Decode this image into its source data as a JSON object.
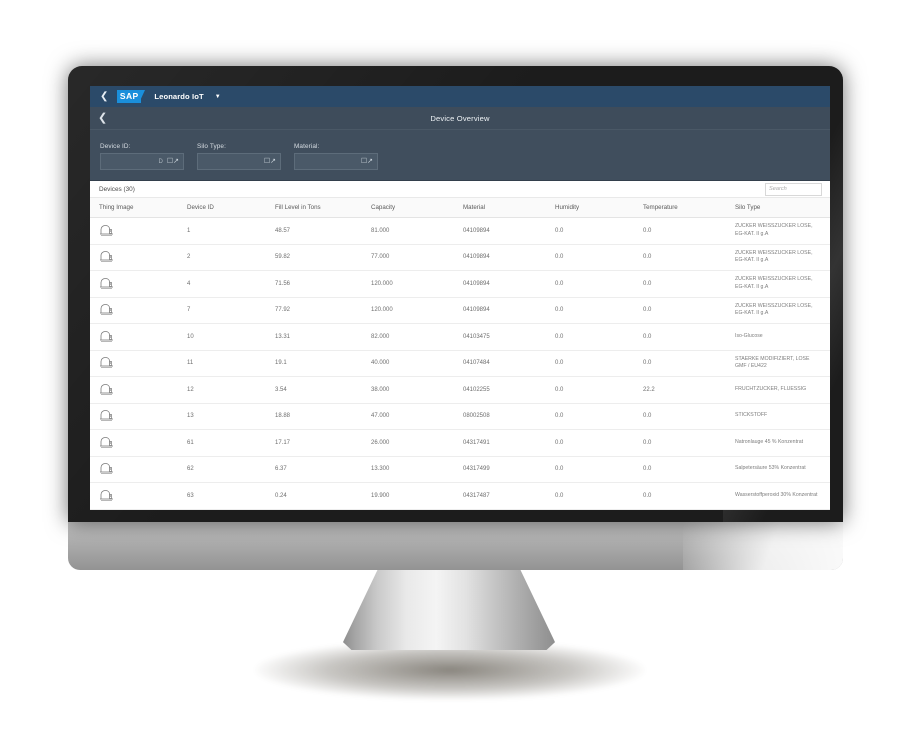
{
  "shell": {
    "back_icon": "chevron-left-icon",
    "logo_text": "SAP",
    "app_title": "Leonardo IoT",
    "caret_icon": "caret-down-icon"
  },
  "page": {
    "back_icon": "chevron-left-icon",
    "title": "Device Overview"
  },
  "filters": [
    {
      "label": "Device ID:",
      "value": "",
      "hint": "D",
      "value_help_icon": "value-help-icon"
    },
    {
      "label": "Silo Type:",
      "value": "",
      "hint": "",
      "value_help_icon": "value-help-icon"
    },
    {
      "label": "Material:",
      "value": "",
      "hint": "",
      "value_help_icon": "value-help-icon"
    }
  ],
  "table": {
    "title": "Devices (30)",
    "search_placeholder": "Search",
    "columns": [
      "Thing Image",
      "Device ID",
      "Fill Level in Tons",
      "Capacity",
      "Material",
      "Humidity",
      "Temperature",
      "Silo Type"
    ],
    "row_icon": "silo-icon",
    "rows": [
      {
        "device_id": "1",
        "fill_level": "48.57",
        "capacity": "81.000",
        "material": "04109894",
        "humidity": "0.0",
        "temperature": "0.0",
        "silo_type": "ZUCKER WEISSZUCKER LOSE, EG-KAT. II g.A"
      },
      {
        "device_id": "2",
        "fill_level": "59.82",
        "capacity": "77.000",
        "material": "04109894",
        "humidity": "0.0",
        "temperature": "0.0",
        "silo_type": "ZUCKER WEISSZUCKER LOSE, EG-KAT. II g.A"
      },
      {
        "device_id": "4",
        "fill_level": "71.56",
        "capacity": "120.000",
        "material": "04109894",
        "humidity": "0.0",
        "temperature": "0.0",
        "silo_type": "ZUCKER WEISSZUCKER LOSE, EG-KAT. II g.A"
      },
      {
        "device_id": "7",
        "fill_level": "77.92",
        "capacity": "120.000",
        "material": "04109894",
        "humidity": "0.0",
        "temperature": "0.0",
        "silo_type": "ZUCKER WEISSZUCKER LOSE, EG-KAT. II g.A"
      },
      {
        "device_id": "10",
        "fill_level": "13.31",
        "capacity": "82.000",
        "material": "04103475",
        "humidity": "0.0",
        "temperature": "0.0",
        "silo_type": "Iso-Glucose"
      },
      {
        "device_id": "11",
        "fill_level": "19.1",
        "capacity": "40.000",
        "material": "04107484",
        "humidity": "0.0",
        "temperature": "0.0",
        "silo_type": "STAERKE MODIFIZIERT, LOSE GMF / EU422"
      },
      {
        "device_id": "12",
        "fill_level": "3.54",
        "capacity": "38.000",
        "material": "04102255",
        "humidity": "0.0",
        "temperature": "22.2",
        "silo_type": "FRUCHTZUCKER, FLUESSIG"
      },
      {
        "device_id": "13",
        "fill_level": "18.88",
        "capacity": "47.000",
        "material": "08002508",
        "humidity": "0.0",
        "temperature": "0.0",
        "silo_type": "STICKSTOFF"
      },
      {
        "device_id": "61",
        "fill_level": "17.17",
        "capacity": "26.000",
        "material": "04317491",
        "humidity": "0.0",
        "temperature": "0.0",
        "silo_type": "Natronlauge 45 % Konzentrat"
      },
      {
        "device_id": "62",
        "fill_level": "6.37",
        "capacity": "13.300",
        "material": "04317499",
        "humidity": "0.0",
        "temperature": "0.0",
        "silo_type": "Salpetersäure 53% Konzentrat"
      },
      {
        "device_id": "63",
        "fill_level": "0.24",
        "capacity": "19.900",
        "material": "04317487",
        "humidity": "0.0",
        "temperature": "0.0",
        "silo_type": "Wasserstoffperoxid 30% Konzentrat"
      }
    ]
  },
  "colors": {
    "shellbar": "#2b4a69",
    "page_header": "#3e4c5b",
    "filter_bar": "#404e5d",
    "sap_blue": "#1a8fdb",
    "bezel": "#1c1c1c"
  }
}
